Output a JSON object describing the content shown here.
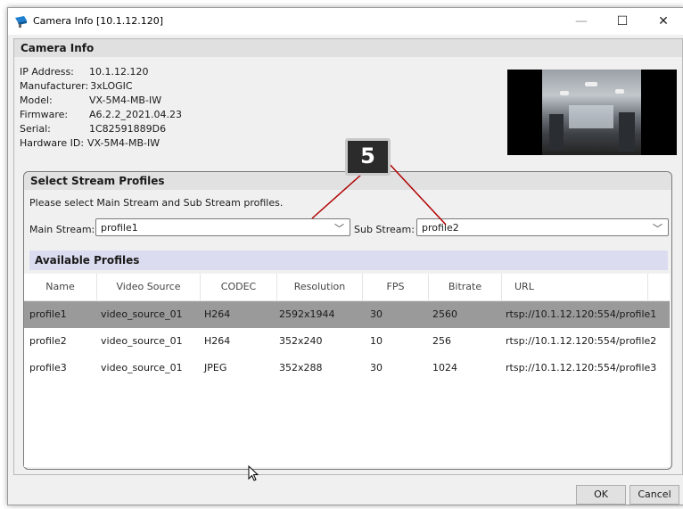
{
  "window": {
    "title": "Camera Info [10.1.12.120]",
    "min_glyph": "—",
    "max_glyph": "☐",
    "close_glyph": "✕"
  },
  "camera_info": {
    "header": "Camera Info",
    "fields": [
      {
        "label": "IP Address:",
        "value": "10.1.12.120"
      },
      {
        "label": "Manufacturer:",
        "value": "3xLOGIC"
      },
      {
        "label": "Model:",
        "value": "VX-5M4-MB-IW"
      },
      {
        "label": "Firmware:",
        "value": "A6.2.2_2021.04.23"
      },
      {
        "label": "Serial:",
        "value": "1C82591889D6"
      },
      {
        "label": "Hardware ID:",
        "value": "VX-5M4-MB-IW"
      }
    ]
  },
  "stream": {
    "header": "Select Stream Profiles",
    "description": "Please select Main Stream and Sub Stream profiles.",
    "main_label": "Main Stream:",
    "main_value": "profile1",
    "sub_label": "Sub Stream:",
    "sub_value": "profile2",
    "arrow": "﹀"
  },
  "profiles": {
    "header": "Available Profiles",
    "columns": [
      "Name",
      "Video Source",
      "CODEC",
      "Resolution",
      "FPS",
      "Bitrate",
      "URL"
    ],
    "rows": [
      [
        "profile1",
        "video_source_01",
        "H264",
        "2592x1944",
        "30",
        "2560",
        "rtsp://10.1.12.120:554/profile1"
      ],
      [
        "profile2",
        "video_source_01",
        "H264",
        "352x240",
        "10",
        "256",
        "rtsp://10.1.12.120:554/profile2"
      ],
      [
        "profile3",
        "video_source_01",
        "JPEG",
        "352x288",
        "30",
        "1024",
        "rtsp://10.1.12.120:554/profile3"
      ]
    ],
    "selected_row": 0
  },
  "callout": {
    "number": "5"
  },
  "buttons": {
    "ok": "OK",
    "cancel": "Cancel"
  },
  "colors": {
    "accent_selected": "#9a9a9a",
    "available_bar": "#dcdcf0",
    "callout_bg": "#2b2b2b",
    "callout_line": "#b00000"
  },
  "icons": {
    "app": "camera-icon",
    "cursor": "mouse-pointer-icon"
  }
}
